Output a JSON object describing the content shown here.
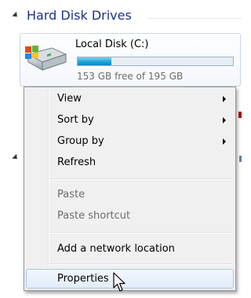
{
  "group": {
    "title": "Hard Disk Drives"
  },
  "drive": {
    "name": "Local Disk (C:)",
    "free_text": "153 GB free of 195 GB",
    "used_fraction": 0.215,
    "bar_color": "#1aa0d8"
  },
  "context_menu": {
    "items": [
      {
        "label": "View",
        "submenu": true,
        "disabled": false
      },
      {
        "label": "Sort by",
        "submenu": true,
        "disabled": false
      },
      {
        "label": "Group by",
        "submenu": true,
        "disabled": false
      },
      {
        "label": "Refresh",
        "submenu": false,
        "disabled": false
      },
      {
        "label": "Paste",
        "submenu": false,
        "disabled": true
      },
      {
        "label": "Paste shortcut",
        "submenu": false,
        "disabled": true
      },
      {
        "label": "Add a network location",
        "submenu": false,
        "disabled": false
      },
      {
        "label": "Properties",
        "submenu": false,
        "disabled": false,
        "highlighted": true
      }
    ]
  },
  "icons": [
    "collapse-arrow-icon",
    "hard-drive-icon",
    "submenu-arrow-icon",
    "mouse-pointer-icon"
  ]
}
